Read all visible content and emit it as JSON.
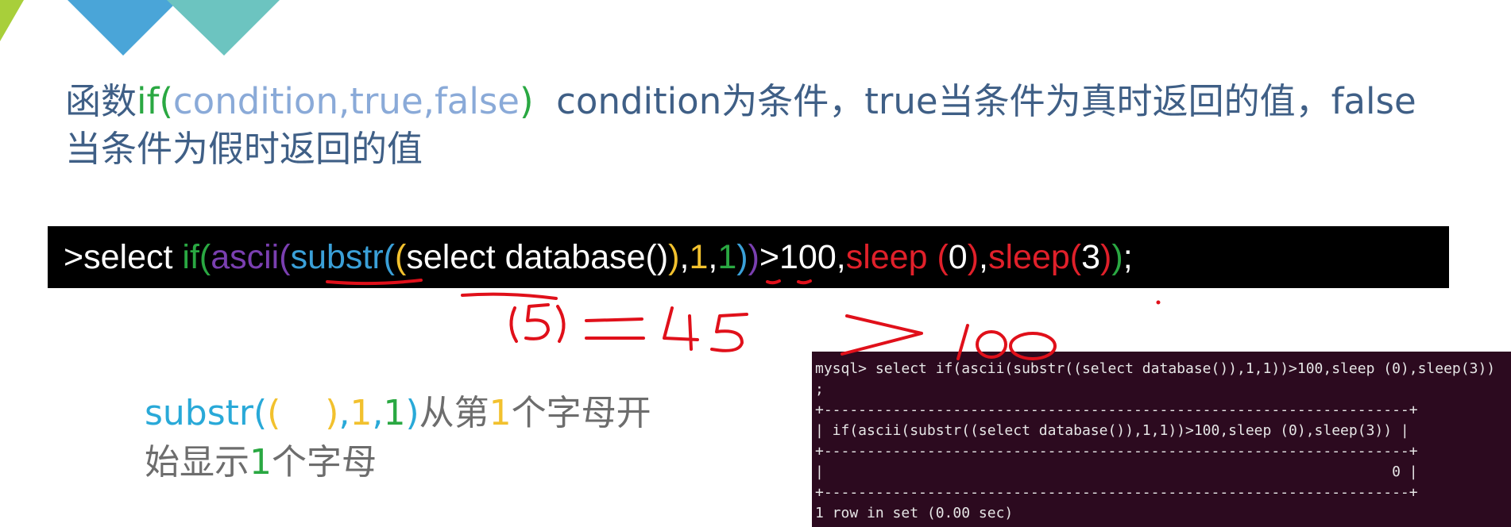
{
  "heading": {
    "line1_prefix": "函数",
    "fn_name": "if(",
    "fn_args": "condition,true,false",
    "fn_close": ")",
    "line1_rest": "condition为条件，true当条件为真时返回的值，false",
    "line2": "当条件为假时返回的值"
  },
  "code": {
    "segments": [
      {
        "text": ">select ",
        "color": "#ffffff"
      },
      {
        "text": "if(",
        "color": "#2aa842"
      },
      {
        "text": "ascii(",
        "color": "#7a3fb0"
      },
      {
        "text": "substr(",
        "color": "#3aa0d8"
      },
      {
        "text": "(",
        "color": "#f2c12e"
      },
      {
        "text": "select database()",
        "color": "#ffffff"
      },
      {
        "text": ")",
        "color": "#f2c12e"
      },
      {
        "text": ",",
        "color": "#ffffff"
      },
      {
        "text": "1",
        "color": "#f2c12e"
      },
      {
        "text": ",",
        "color": "#ffffff"
      },
      {
        "text": "1",
        "color": "#2aa842"
      },
      {
        "text": ")",
        "color": "#3aa0d8"
      },
      {
        "text": ")",
        "color": "#7a3fb0"
      },
      {
        "text": ">100,",
        "color": "#ffffff"
      },
      {
        "text": "sleep ",
        "color": "#e0202a"
      },
      {
        "text": "(",
        "color": "#e0202a"
      },
      {
        "text": "0",
        "color": "#ffffff"
      },
      {
        "text": ")",
        "color": "#e0202a"
      },
      {
        "text": ",",
        "color": "#ffffff"
      },
      {
        "text": "sleep",
        "color": "#e0202a"
      },
      {
        "text": "(",
        "color": "#e0202a"
      },
      {
        "text": "3",
        "color": "#ffffff"
      },
      {
        "text": ")",
        "color": "#e0202a"
      },
      {
        "text": ")",
        "color": "#2aa842"
      },
      {
        "text": ";",
        "color": "#ffffff"
      }
    ]
  },
  "note": {
    "line1": [
      {
        "text": "substr(",
        "color": "#29a9d8"
      },
      {
        "text": "(",
        "color": "#f2c12e"
      },
      {
        "text": "    ",
        "color": "#6d6d6d"
      },
      {
        "text": ")",
        "color": "#f2c12e"
      },
      {
        "text": ",",
        "color": "#29a9d8"
      },
      {
        "text": "1",
        "color": "#f2c12e"
      },
      {
        "text": ",",
        "color": "#29a9d8"
      },
      {
        "text": "1",
        "color": "#2aa842"
      },
      {
        "text": ")",
        "color": "#29a9d8"
      },
      {
        "text": "从第",
        "color": "#6d6d6d"
      },
      {
        "text": "1",
        "color": "#f2c12e"
      },
      {
        "text": "个字母开",
        "color": "#6d6d6d"
      }
    ],
    "line2": [
      {
        "text": "始显示",
        "color": "#6d6d6d"
      },
      {
        "text": "1",
        "color": "#2aa842"
      },
      {
        "text": "个字母",
        "color": "#6d6d6d"
      }
    ]
  },
  "handwriting_text": "(5)=45 > 100",
  "terminal": {
    "lines": [
      "mysql> select if(ascii(substr((select database()),1,1))>100,sleep (0),sleep(3))",
      ";",
      "+--------------------------------------------------------------------+",
      "| if(ascii(substr((select database()),1,1))>100,sleep (0),sleep(3)) |",
      "+--------------------------------------------------------------------+",
      "|                                                                  0 |",
      "+--------------------------------------------------------------------+",
      "1 row in set (0.00 sec)"
    ]
  },
  "colors": {
    "heading_text": "#3f5f86",
    "function_green": "#2aa842",
    "args_blue": "#8aaad8",
    "terminal_bg": "#2c0a1f",
    "annotation_red": "#e0101a",
    "decor_teal": "#6cc4c0",
    "decor_blue": "#4aa5d8",
    "decor_lime": "#a8cf3a"
  }
}
